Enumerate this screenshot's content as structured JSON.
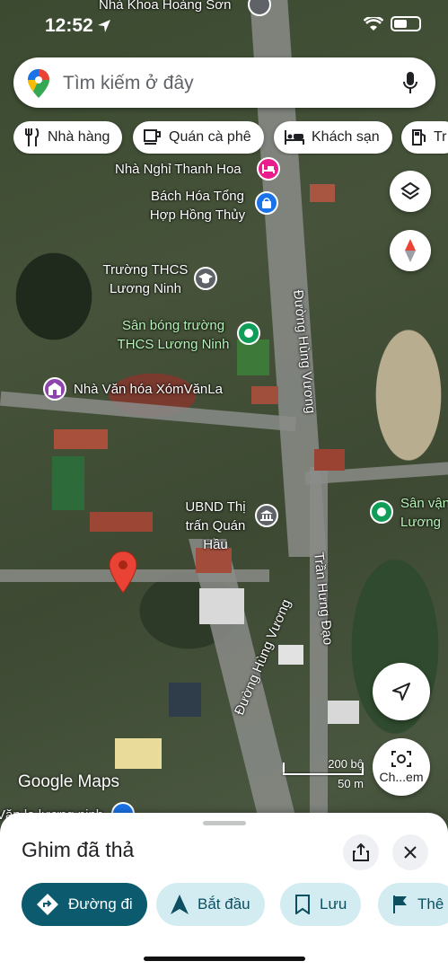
{
  "status_bar": {
    "time": "12:52"
  },
  "search": {
    "placeholder": "Tìm kiếm ở đây"
  },
  "chips": [
    {
      "label": "Nhà hàng",
      "icon": "restaurant-icon"
    },
    {
      "label": "Quán cà phê",
      "icon": "coffee-icon"
    },
    {
      "label": "Khách sạn",
      "icon": "hotel-icon"
    },
    {
      "label": "Tr",
      "icon": "gas-station-icon"
    }
  ],
  "map": {
    "places": {
      "top_cut": "Nhà Khoa Hoàng Sơn",
      "guesthouse": "Nhà Nghỉ Thanh Hoa",
      "store": "Bách Hóa Tổng Hợp Hồng Thủy",
      "school": "Trường THCS Lương Ninh",
      "stadium": "Sân bóng trường THCS Lương Ninh",
      "culture_house": "Nhà Văn hóa XómVănLa",
      "ubnd": "UBND Thị trấn Quán Hầu",
      "sports_right": "Sân vận Lương",
      "bottom_cut": "Văn la lương ninh"
    },
    "streets": {
      "hung_vuong_top": "Đường Hùng Vương",
      "hung_vuong_bottom": "Đường Hùng Vương",
      "tran_hung_dao": "Trần Hưng Đạo"
    },
    "attribution": "Google Maps",
    "scale": {
      "top": "200 bộ",
      "bottom": "50 m"
    },
    "camera_label": "Ch...em"
  },
  "sheet": {
    "title": "Ghim đã thả",
    "actions": [
      {
        "label": "Đường đi"
      },
      {
        "label": "Bắt đầu"
      },
      {
        "label": "Lưu"
      },
      {
        "label": "Thê"
      }
    ]
  },
  "colors": {
    "accent": "#0b5a6e",
    "secondary_bg": "#d3ecf2",
    "pin": "#ea4335",
    "place_green": "#0f9d58",
    "place_purple": "#8e44ad",
    "place_pink": "#e91e8c",
    "place_blue": "#1a73e8",
    "place_gray": "#5f6368"
  }
}
